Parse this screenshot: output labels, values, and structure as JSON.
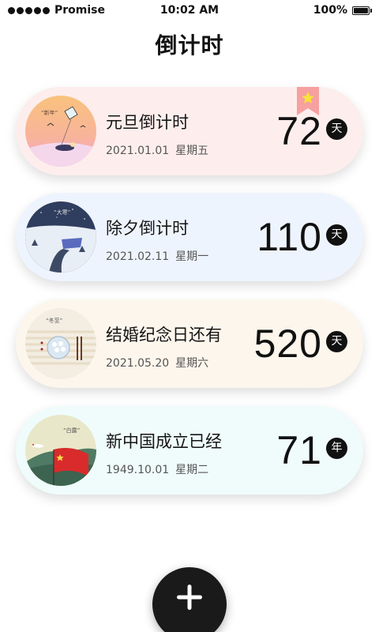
{
  "status_bar": {
    "carrier": "Promise",
    "time": "10:02 AM",
    "battery": "100%",
    "battery_level": 1.0
  },
  "page": {
    "title": "倒计时"
  },
  "cards": [
    {
      "title": "元旦倒计时",
      "date": "2021.01.01",
      "weekday": "星期五",
      "count": "72",
      "unit": "天",
      "icon": "kite-new-year-illustration",
      "bookmarked": true,
      "icon_caption": "“新年”"
    },
    {
      "title": "除夕倒计时",
      "date": "2021.02.11",
      "weekday": "星期一",
      "count": "110",
      "unit": "天",
      "icon": "snowy-night-house-illustration",
      "icon_caption": "“大寒”"
    },
    {
      "title": "结婚纪念日还有",
      "date": "2021.05.20",
      "weekday": "星期六",
      "count": "520",
      "unit": "天",
      "icon": "dumpling-chopsticks-illustration",
      "icon_caption": "“冬至”"
    },
    {
      "title": "新中国成立已经",
      "date": "1949.10.01",
      "weekday": "星期二",
      "count": "71",
      "unit": "年",
      "icon": "national-flag-crane-illustration",
      "icon_caption": "“白露”"
    }
  ],
  "colors": {
    "card_1_bg": "#fdeeed",
    "card_2_bg": "#eef4fd",
    "card_3_bg": "#fdf6ec",
    "card_4_bg": "#effcfb",
    "bookmark": "#f6a0a0",
    "bookmark_star": "#f7e23a",
    "add_button": "#1a1a1a"
  },
  "add_button": {
    "icon": "plus-icon"
  }
}
